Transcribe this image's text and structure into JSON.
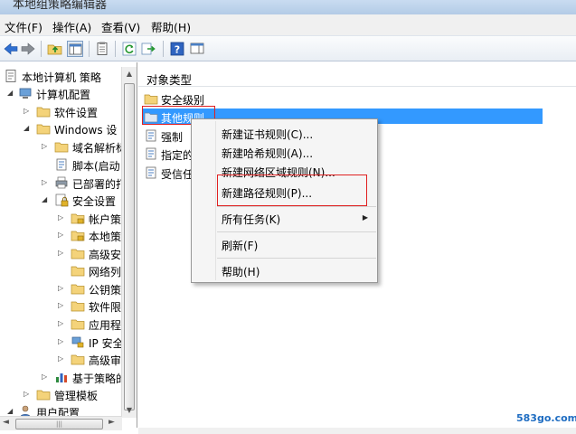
{
  "window": {
    "title": "本地组策略编辑器"
  },
  "menu": [
    "文件(F)",
    "操作(A)",
    "查看(V)",
    "帮助(H)"
  ],
  "toolbar_icons": [
    "back-arrow-icon",
    "forward-arrow-icon",
    "up-folder-icon",
    "show-hide-tree-icon",
    "properties-icon",
    "refresh-icon",
    "export-list-icon",
    "help-icon",
    "action-pane-icon"
  ],
  "tree": {
    "root": "本地计算机 策略",
    "computer_config": "计算机配置",
    "software_settings": "软件设置",
    "windows_settings": "Windows 设",
    "dns_policy": "域名解析标",
    "scripts": "脚本(启动",
    "deployed_printers": "已部署的打",
    "security_settings": "安全设置",
    "account_policies": "帐户策",
    "local_policies": "本地策",
    "advanced_security": "高级安",
    "network_list": "网络列",
    "public_key": "公钥策",
    "software_restriction": "软件限",
    "app_control": "应用程",
    "ip_security": "IP 安全",
    "advanced_audit": "高级审",
    "policy_qos": "基于策略的",
    "admin_templates": "管理模板",
    "user_config": "用户配置"
  },
  "scroll": {
    "left_arrow": "◄",
    "right_arrow": "►",
    "up_arrow": "▲",
    "down_arrow": "▼",
    "grip": "|||"
  },
  "list": {
    "header": "对象类型",
    "items": [
      "安全级别",
      "其他规则",
      "强制",
      "指定的",
      "受信任"
    ]
  },
  "context_menu": {
    "new_cert_rule": "新建证书规则(C)...",
    "new_hash_rule": "新建哈希规则(A)...",
    "new_zone_rule": "新建网络区域规则(N)...",
    "new_path_rule": "新建路径规则(P)...",
    "all_tasks": "所有任务(K)",
    "submenu_arrow": "▶",
    "refresh": "刷新(F)",
    "help": "帮助(H)"
  },
  "watermark": "583go.com",
  "colors": {
    "selection": "#3399ff",
    "highlight_box": "#e02020",
    "menu_bg": "#f5f5f5"
  }
}
